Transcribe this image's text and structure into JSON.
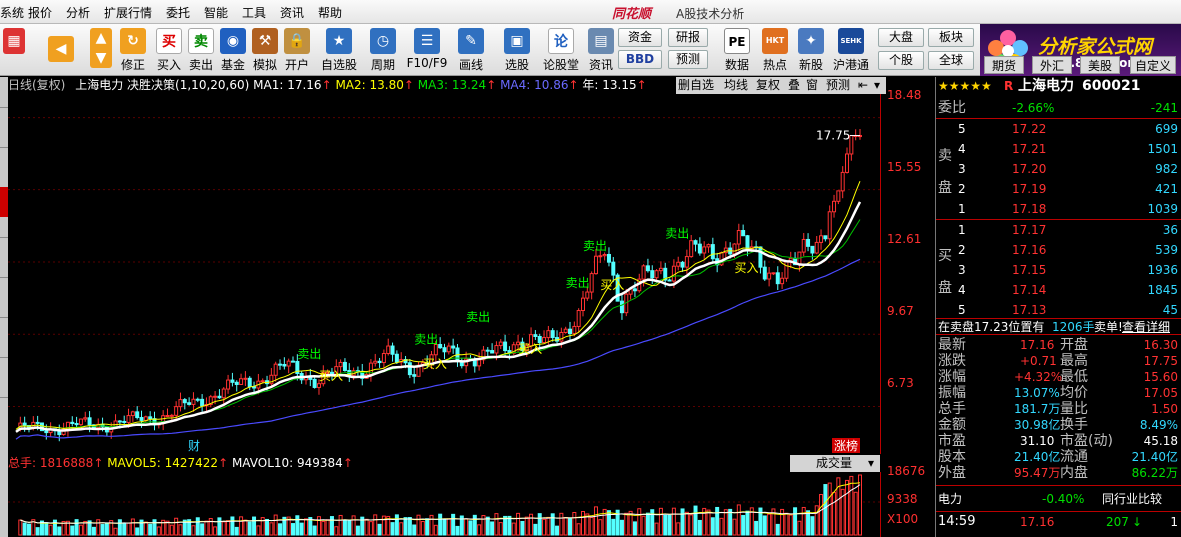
{
  "menu": [
    "系统",
    "报价",
    "分析",
    "扩展行情",
    "委托",
    "智能",
    "工具",
    "资讯",
    "帮助"
  ],
  "brand": "同花顺",
  "app_title": "A股技术分析",
  "toolbar": {
    "buttons": [
      "修正",
      "买入",
      "卖出",
      "基金",
      "模拟",
      "开户",
      "自选股",
      "周期",
      "F10/F9",
      "画线",
      "选股",
      "论股堂",
      "资讯",
      "数据",
      "热点",
      "新股",
      "沪港通"
    ],
    "small": {
      "zijin": "资金",
      "yanbao": "研报",
      "bbd": "BBD",
      "yuce": "预测",
      "dapan": "大盘",
      "banku": "板块",
      "gegu": "个股",
      "quanqiu": "全球",
      "qihuo": "期货",
      "waihui": "外汇",
      "meigu": "美股",
      "zidingyi": "自定义"
    },
    "icon_labels": {
      "pe": "PE",
      "hkt": "HKT",
      "hk": "SEHK"
    }
  },
  "logo": {
    "title": "分析家公式网",
    "url": "www.88gs.com"
  },
  "chart": {
    "header": {
      "period": "日线(复权)",
      "name": "上海电力",
      "indicator": "决胜决策(1,10,20,60)",
      "ma1": "MA1: 17.16",
      "ma2": "MA2: 13.80",
      "ma3": "MA3: 13.24",
      "ma4": "MA4: 10.86",
      "year": "年: 13.15"
    },
    "tools": [
      "删自选",
      "均线",
      "复权",
      "叠",
      "窗",
      "预测"
    ],
    "price_ticks": [
      "18.48",
      "15.55",
      "12.61",
      "9.67",
      "6.73"
    ],
    "high_label": "17.75",
    "signals": {
      "sell": "卖出",
      "buy": "买入"
    },
    "marker_cai": "财",
    "marker_zhangbang": "涨榜",
    "volume": {
      "total": "总手: 1816888",
      "mavol5": "MAVOL5: 1427422",
      "mavol10": "MAVOL10: 949384",
      "select": "成交量",
      "ticks": [
        "18676",
        "9338",
        "X100"
      ]
    },
    "colors": {
      "up": "#ff3232",
      "down": "#54ffff",
      "ma1": "#ffffff",
      "ma2": "#ffff00",
      "ma3": "#00c000",
      "ma4": "#4a4aff",
      "sell": "#00ff00",
      "buy": "#ffff00"
    }
  },
  "chart_data": {
    "type": "candlestick",
    "title": "上海电力 日线(复权)",
    "ylim": [
      6.73,
      18.48
    ],
    "price_points": [
      [
        0,
        5.8
      ],
      [
        10,
        5.9
      ],
      [
        18,
        6.0
      ],
      [
        25,
        6.1
      ],
      [
        35,
        6.4
      ],
      [
        45,
        7.2
      ],
      [
        55,
        7.8
      ],
      [
        62,
        8.3
      ],
      [
        70,
        7.9
      ],
      [
        78,
        8.2
      ],
      [
        86,
        8.7
      ],
      [
        92,
        8.4
      ],
      [
        100,
        9.0
      ],
      [
        108,
        8.6
      ],
      [
        116,
        9.5
      ],
      [
        122,
        9.2
      ],
      [
        130,
        10.5
      ],
      [
        136,
        13.1
      ],
      [
        140,
        11.2
      ],
      [
        146,
        11.9
      ],
      [
        152,
        12.6
      ],
      [
        160,
        13.0
      ],
      [
        166,
        13.5
      ],
      [
        172,
        12.5
      ],
      [
        176,
        12.3
      ],
      [
        180,
        12.4
      ],
      [
        186,
        13.8
      ],
      [
        190,
        15.5
      ],
      [
        193,
        17.75
      ]
    ],
    "ma_last": {
      "MA1": 17.16,
      "MA2": 13.8,
      "MA3": 13.24,
      "MA4": 10.86
    }
  },
  "quote": {
    "stars": "★★★★★",
    "r": "R",
    "name": "上海电力",
    "code": "600021",
    "weibi": {
      "label": "委比",
      "pct": "-2.66%",
      "diff": "-241"
    },
    "sell_label": [
      "卖",
      "盘"
    ],
    "buy_label": [
      "买",
      "盘"
    ],
    "asks": [
      {
        "lv": "5",
        "p": "17.22",
        "v": "699"
      },
      {
        "lv": "4",
        "p": "17.21",
        "v": "1501"
      },
      {
        "lv": "3",
        "p": "17.20",
        "v": "982"
      },
      {
        "lv": "2",
        "p": "17.19",
        "v": "421"
      },
      {
        "lv": "1",
        "p": "17.18",
        "v": "1039"
      }
    ],
    "bids": [
      {
        "lv": "1",
        "p": "17.17",
        "v": "36"
      },
      {
        "lv": "2",
        "p": "17.16",
        "v": "539"
      },
      {
        "lv": "3",
        "p": "17.15",
        "v": "1936"
      },
      {
        "lv": "4",
        "p": "17.14",
        "v": "1845"
      },
      {
        "lv": "5",
        "p": "17.13",
        "v": "45"
      }
    ],
    "info": {
      "a": "在卖盘17.23位置有",
      "b": "1206手",
      "c": "卖单!",
      "d": "查看详细"
    },
    "stats": [
      {
        "l1": "最新",
        "v1": "17.16",
        "l2": "开盘",
        "v2": "16.30"
      },
      {
        "l1": "涨跌",
        "v1": "+0.71",
        "l2": "最高",
        "v2": "17.75"
      },
      {
        "l1": "涨幅",
        "v1": "+4.32%",
        "l2": "最低",
        "v2": "15.60"
      },
      {
        "l1": "振幅",
        "v1": "13.07%",
        "l2": "均价",
        "v2": "17.05"
      },
      {
        "l1": "总手",
        "v1": "181.7万",
        "l2": "量比",
        "v2": "1.50"
      },
      {
        "l1": "金额",
        "v1": "30.98亿",
        "l2": "换手",
        "v2": "8.49%"
      },
      {
        "l1": "市盈",
        "v1": "31.10",
        "l2": "市盈(动)",
        "v2": "45.18"
      },
      {
        "l1": "股本",
        "v1": "21.40亿",
        "l2": "流通",
        "v2": "21.40亿"
      },
      {
        "l1": "外盘",
        "v1": "95.47万",
        "l2": "内盘",
        "v2": "86.22万"
      }
    ],
    "industry": {
      "name": "电力",
      "pct": "-0.40%",
      "btn": "同行业比较"
    },
    "tick": {
      "time": "14:59",
      "price": "17.16",
      "vol": "207",
      "arrow": "↓",
      "n": "1"
    }
  }
}
